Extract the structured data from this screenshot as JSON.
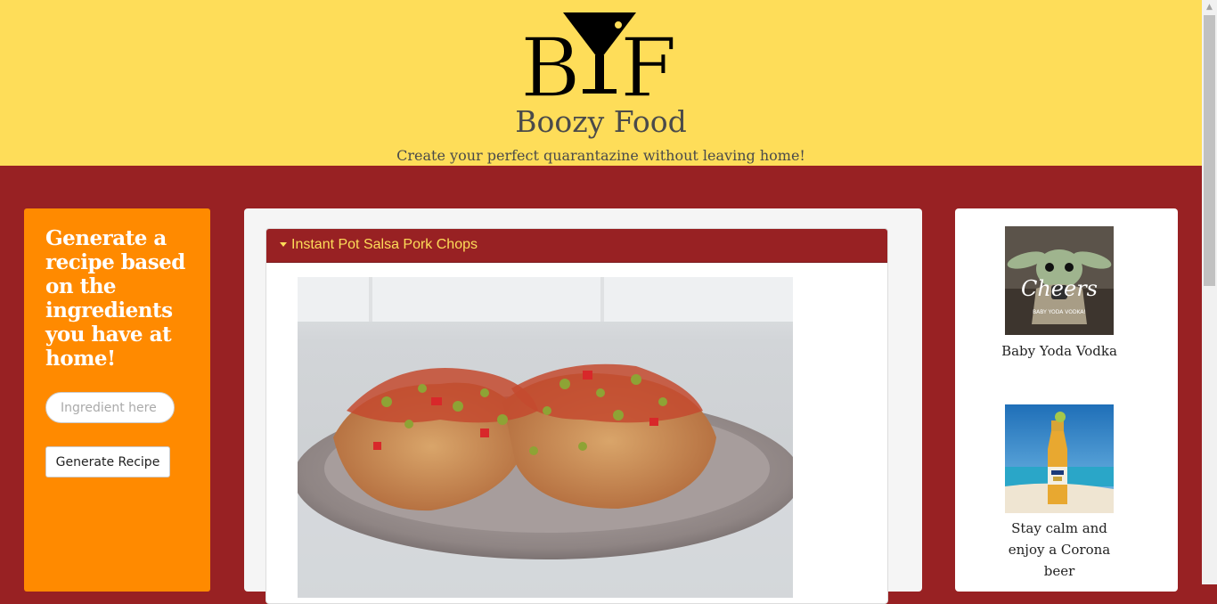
{
  "header": {
    "logo_text": "BYF",
    "brand": "Boozy Food",
    "tagline": "Create your perfect quarantazine without leaving home!"
  },
  "sidebar": {
    "heading": "Generate a recipe based on the ingredients you have at home!",
    "input_placeholder": "Ingredient here",
    "button_label": "Generate Recipe"
  },
  "recipe": {
    "title": "Instant Pot Salsa Pork Chops",
    "image": "salsa-pork-chops-photo"
  },
  "products": [
    {
      "caption": "Baby Yoda Vodka",
      "image_text": "Cheers",
      "image_subtext": "BABY YODA VODKA!"
    },
    {
      "caption": "Stay calm and enjoy a Corona beer",
      "image": "corona-beer-photo"
    }
  ],
  "colors": {
    "header_bg": "#fedd59",
    "page_bg": "#982123",
    "sidebar_bg": "#ff8a00",
    "accent_text": "#fedd59"
  }
}
